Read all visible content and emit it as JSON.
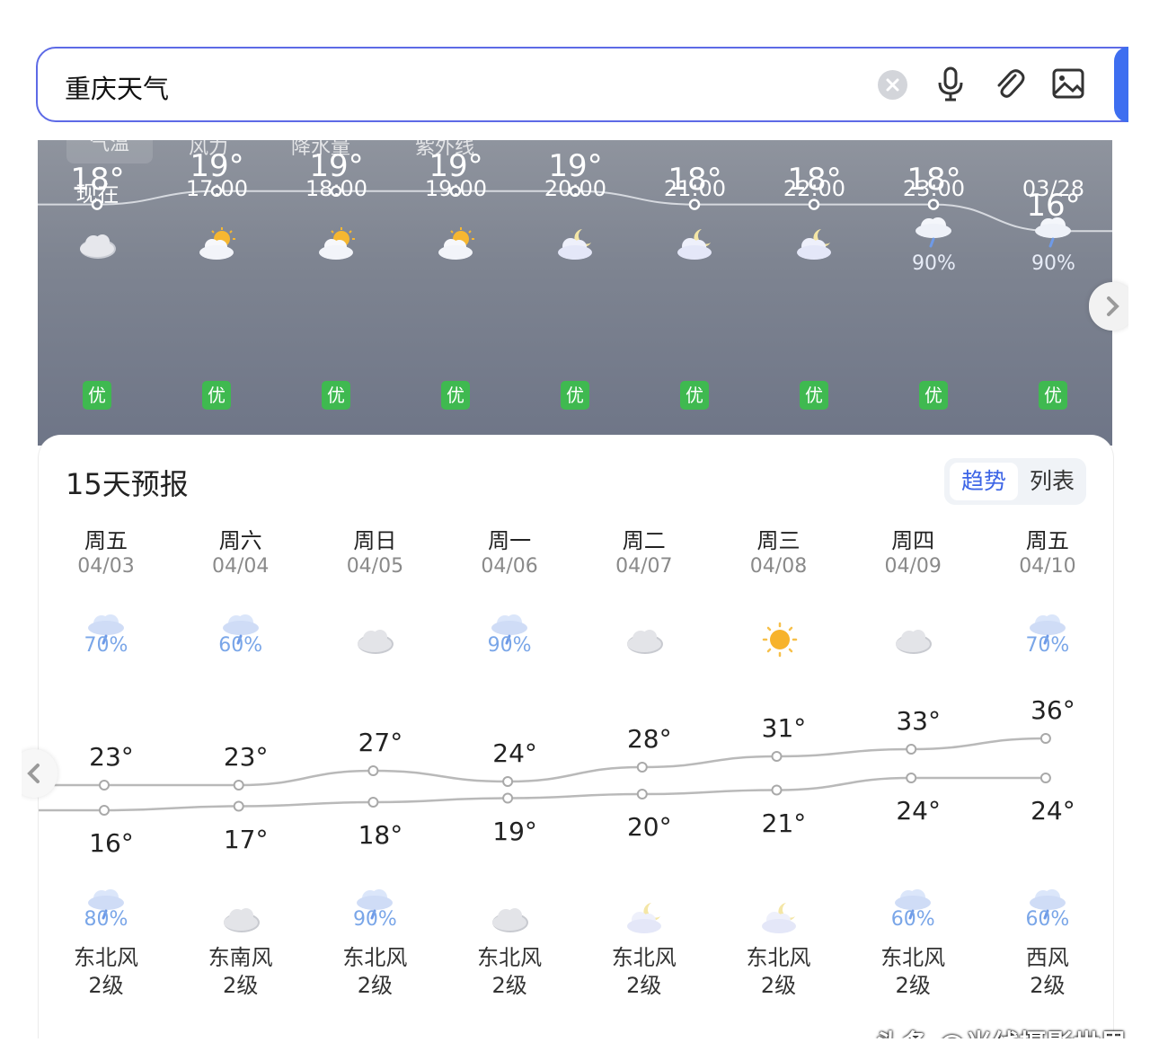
{
  "search": {
    "query": "重庆天气"
  },
  "hourly": {
    "tabs": [
      {
        "label": "气温",
        "active": true
      },
      {
        "label": "风力",
        "active": false
      },
      {
        "label": "降水量",
        "active": false
      },
      {
        "label": "紫外线",
        "active": false
      }
    ],
    "items": [
      {
        "time": "现在",
        "icon": "cloudy-icon",
        "rain": "",
        "temp": "18°",
        "temp_value": 18,
        "aqi": "优"
      },
      {
        "time": "17:00",
        "icon": "partly-sunny-icon",
        "rain": "",
        "temp": "19°",
        "temp_value": 19,
        "aqi": "优"
      },
      {
        "time": "18:00",
        "icon": "partly-sunny-icon",
        "rain": "",
        "temp": "19°",
        "temp_value": 19,
        "aqi": "优"
      },
      {
        "time": "19:00",
        "icon": "partly-sunny-icon",
        "rain": "",
        "temp": "19°",
        "temp_value": 19,
        "aqi": "优"
      },
      {
        "time": "20:00",
        "icon": "moon-cloud-icon",
        "rain": "",
        "temp": "19°",
        "temp_value": 19,
        "aqi": "优"
      },
      {
        "time": "21:00",
        "icon": "moon-cloud-icon",
        "rain": "",
        "temp": "18°",
        "temp_value": 18,
        "aqi": "优"
      },
      {
        "time": "22:00",
        "icon": "moon-cloud-icon",
        "rain": "",
        "temp": "18°",
        "temp_value": 18,
        "aqi": "优"
      },
      {
        "time": "23:00",
        "icon": "rain-cloud-icon",
        "rain": "90%",
        "temp": "18°",
        "temp_value": 18,
        "aqi": "优"
      },
      {
        "time": "03/28",
        "icon": "rain-cloud-icon",
        "rain": "90%",
        "temp": "16°",
        "temp_value": 16,
        "aqi": "优"
      }
    ]
  },
  "forecast": {
    "title": "15天预报",
    "toggle": {
      "trend": "趋势",
      "list": "列表"
    },
    "days": [
      {
        "week": "周五",
        "date": "04/03",
        "icon_day": "rain-cloud-icon",
        "rain_day": "70%",
        "high": "23°",
        "high_value": 23,
        "low": "16°",
        "low_value": 16,
        "icon_night": "rain-cloud-icon",
        "rain_night": "80%",
        "wind": "东北风",
        "level": "2级"
      },
      {
        "week": "周六",
        "date": "04/04",
        "icon_day": "rain-cloud-icon",
        "rain_day": "60%",
        "high": "23°",
        "high_value": 23,
        "low": "17°",
        "low_value": 17,
        "icon_night": "cloudy-icon",
        "rain_night": "",
        "wind": "东南风",
        "level": "2级"
      },
      {
        "week": "周日",
        "date": "04/05",
        "icon_day": "cloudy-icon",
        "rain_day": "",
        "high": "27°",
        "high_value": 27,
        "low": "18°",
        "low_value": 18,
        "icon_night": "rain-cloud-icon",
        "rain_night": "90%",
        "wind": "东北风",
        "level": "2级"
      },
      {
        "week": "周一",
        "date": "04/06",
        "icon_day": "rain-cloud-icon",
        "rain_day": "90%",
        "high": "24°",
        "high_value": 24,
        "low": "19°",
        "low_value": 19,
        "icon_night": "cloudy-icon",
        "rain_night": "",
        "wind": "东北风",
        "level": "2级"
      },
      {
        "week": "周二",
        "date": "04/07",
        "icon_day": "cloudy-icon",
        "rain_day": "",
        "high": "28°",
        "high_value": 28,
        "low": "20°",
        "low_value": 20,
        "icon_night": "moon-cloud-icon",
        "rain_night": "",
        "wind": "东北风",
        "level": "2级"
      },
      {
        "week": "周三",
        "date": "04/08",
        "icon_day": "sun-icon",
        "rain_day": "",
        "high": "31°",
        "high_value": 31,
        "low": "21°",
        "low_value": 21,
        "icon_night": "moon-cloud-icon",
        "rain_night": "",
        "wind": "东北风",
        "level": "2级"
      },
      {
        "week": "周四",
        "date": "04/09",
        "icon_day": "cloudy-icon",
        "rain_day": "",
        "high": "33°",
        "high_value": 33,
        "low": "24°",
        "low_value": 24,
        "icon_night": "rain-cloud-icon",
        "rain_night": "60%",
        "wind": "东北风",
        "level": "2级"
      },
      {
        "week": "周五",
        "date": "04/10",
        "icon_day": "rain-cloud-icon",
        "rain_day": "70%",
        "high": "36°",
        "high_value": 36,
        "low": "24°",
        "low_value": 24,
        "icon_night": "rain-cloud-icon",
        "rain_night": "60%",
        "wind": "西风",
        "level": "2级"
      }
    ]
  },
  "watermark": "头条 @光线摄影世界"
}
